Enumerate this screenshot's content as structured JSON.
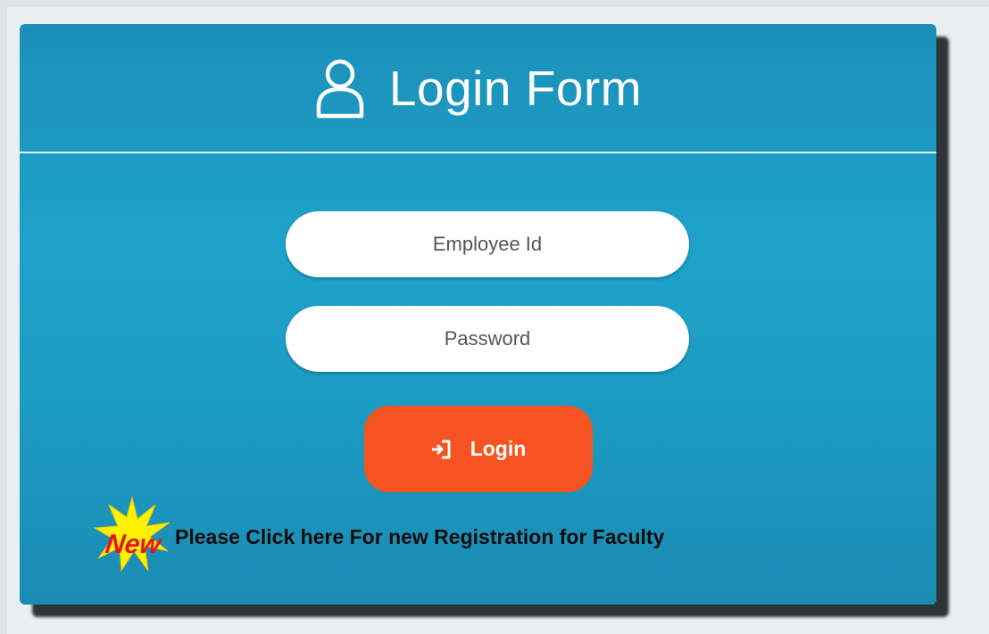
{
  "header": {
    "title": "Login Form",
    "icon": "user-icon"
  },
  "form": {
    "employee_id": {
      "value": "",
      "placeholder": "Employee Id"
    },
    "password": {
      "value": "",
      "placeholder": "Password"
    },
    "login_label": "Login",
    "login_icon": "sign-in-icon"
  },
  "registration": {
    "badge_text": "New",
    "link_text": "Please Click here For new Registration for Faculty"
  },
  "colors": {
    "card": "#1c9dc4",
    "login_button": "#f5531f",
    "badge_star": "#fff200",
    "badge_text": "#e8141b"
  }
}
